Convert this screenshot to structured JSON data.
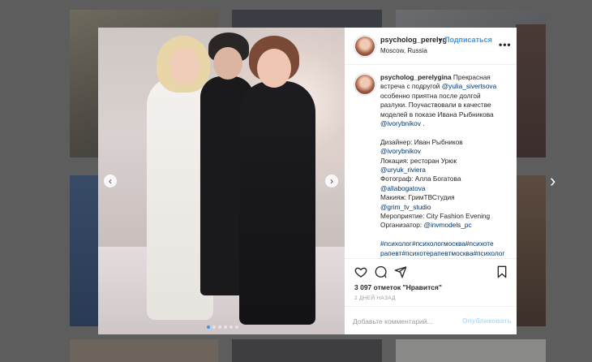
{
  "colors": {
    "accent": "#3897f0",
    "overlay": "#5d5d5d",
    "link": "#003569"
  },
  "post": {
    "header": {
      "username": "psycholog_perelyg",
      "separator": "•",
      "follow_label": "Подписаться",
      "location": "Moscow, Russia",
      "more_label": "•••"
    },
    "caption": {
      "username": "psycholog_perelygina",
      "lines": [
        {
          "text": "Прекрасная",
          "inline_after_user": true
        },
        {
          "parts": [
            {
              "t": "встреча с подругой "
            },
            {
              "t": "@yulia_sivertsova",
              "link": true
            }
          ]
        },
        {
          "parts": [
            {
              "t": "особенно приятна после долгой"
            }
          ]
        },
        {
          "parts": [
            {
              "t": "разлуки. Поучаствовали в качестве"
            }
          ]
        },
        {
          "parts": [
            {
              "t": "моделей в показе Ивана Рыбникова"
            }
          ]
        },
        {
          "parts": [
            {
              "t": "@ivorybnikov",
              "link": true
            },
            {
              "t": " ."
            }
          ]
        },
        {
          "gap": true
        },
        {
          "parts": [
            {
              "t": "Дизайнер: Иван Рыбников"
            }
          ]
        },
        {
          "parts": [
            {
              "t": "@ivorybnikov",
              "link": true
            }
          ]
        },
        {
          "parts": [
            {
              "t": "Локация: ресторан Урюк"
            }
          ]
        },
        {
          "parts": [
            {
              "t": "@uryuk_riviera",
              "link": true
            }
          ]
        },
        {
          "parts": [
            {
              "t": "Фотограф: Алла Богатова"
            }
          ]
        },
        {
          "parts": [
            {
              "t": "@allabogatova",
              "link": true
            }
          ]
        },
        {
          "parts": [
            {
              "t": "Макияж: ГримТВСтудия"
            }
          ]
        },
        {
          "parts": [
            {
              "t": "@grim_tv_studio",
              "link": true
            }
          ]
        },
        {
          "parts": [
            {
              "t": "Мероприятие: City Fashion Evening"
            }
          ]
        },
        {
          "parts": [
            {
              "t": "Организатор: "
            },
            {
              "t": "@invmodels_pc",
              "link": true
            }
          ]
        },
        {
          "gap": true
        },
        {
          "parts": [
            {
              "t": "#психолог#психологмосква#психоте",
              "link": true
            }
          ]
        },
        {
          "parts": [
            {
              "t": "рапевт#психотерапевтмосква#психолог",
              "link": true
            }
          ]
        }
      ]
    },
    "likes": "3 097 отметок \"Нравится\"",
    "date": "2 ДНЕЙ НАЗАД",
    "comment": {
      "placeholder": "Добавьте комментарий...",
      "value": "",
      "publish_label": "Опубликовать"
    },
    "icons": {
      "like": "heart-icon",
      "comment": "comment-icon",
      "share": "share-icon",
      "save": "bookmark-icon"
    },
    "carousel": {
      "prev": "‹",
      "next": "›",
      "total": 6,
      "active": 1
    }
  },
  "page": {
    "next_arrow": "›"
  }
}
